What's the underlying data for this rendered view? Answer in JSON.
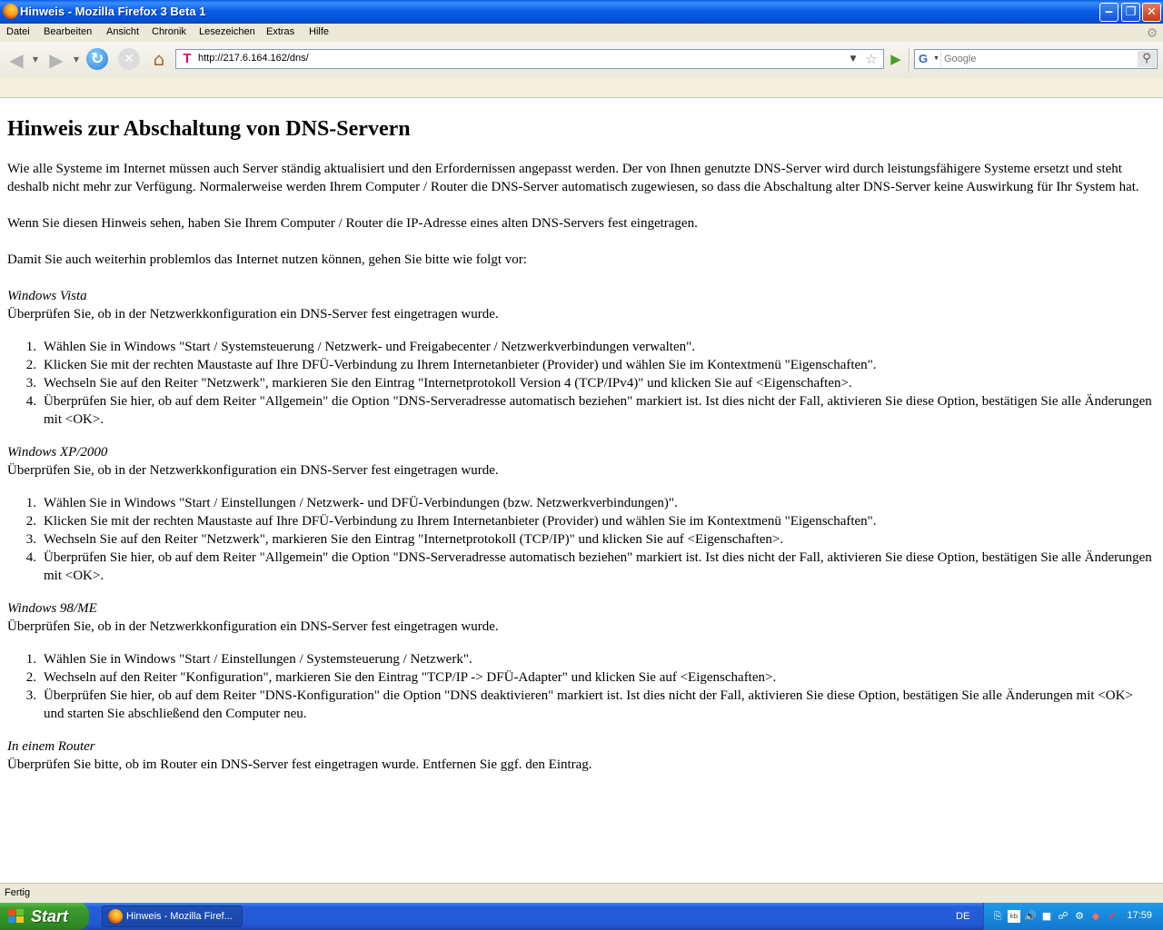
{
  "window": {
    "title": "Hinweis - Mozilla Firefox 3 Beta 1",
    "min_glyph": "‒",
    "max_glyph": "❐",
    "close_glyph": "✕"
  },
  "menu": {
    "items": [
      "Datei",
      "Bearbeiten",
      "Ansicht",
      "Chronik",
      "Lesezeichen",
      "Extras",
      "Hilfe"
    ]
  },
  "toolbar": {
    "back_glyph": "◀",
    "forward_glyph": "▶",
    "reload_glyph": "↻",
    "stop_glyph": "✕",
    "home_glyph": "⌂",
    "site_icon_letter": "T",
    "url": "http://217.6.164.162/dns/",
    "star_glyph": "☆",
    "go_glyph": "▶",
    "search_engine_letter": "G",
    "search_placeholder": "Google",
    "search_glyph": "⚲"
  },
  "page": {
    "heading": "Hinweis zur Abschaltung von DNS-Servern",
    "intro": "Wie alle Systeme im Internet müssen auch Server ständig aktualisiert und den Erfordernissen angepasst werden. Der von Ihnen genutzte DNS-Server wird durch leistungsfähigere Systeme ersetzt und steht deshalb nicht mehr zur Verfügung. Normalerweise werden Ihrem Computer / Router die DNS-Server automatisch zugewiesen, so dass die Abschaltung alter DNS-Server keine Auswirkung für Ihr System hat.",
    "para2": "Wenn Sie diesen Hinweis sehen, haben Sie Ihrem Computer / Router die IP-Adresse eines alten DNS-Servers fest eingetragen.",
    "para3": "Damit Sie auch weiterhin problemlos das Internet nutzen können, gehen Sie bitte wie folgt vor:",
    "sections": [
      {
        "title": "Windows Vista",
        "lead": "Überprüfen Sie, ob in der Netzwerkkonfiguration ein DNS-Server fest eingetragen wurde.",
        "steps": [
          "Wählen Sie in Windows \"Start / Systemsteuerung / Netzwerk- und Freigabecenter / Netzwerkverbindungen verwalten\".",
          "Klicken Sie mit der rechten Maustaste auf Ihre DFÜ-Verbindung zu Ihrem Internetanbieter (Provider) und wählen Sie im Kontextmenü \"Eigenschaften\".",
          "Wechseln Sie auf den Reiter \"Netzwerk\", markieren Sie den Eintrag \"Internetprotokoll Version 4 (TCP/IPv4)\" und klicken Sie auf <Eigenschaften>.",
          "Überprüfen Sie hier, ob auf dem Reiter \"Allgemein\" die Option \"DNS-Serveradresse automatisch beziehen\" markiert ist. Ist dies nicht der Fall, aktivieren Sie diese Option, bestätigen Sie alle Änderungen mit <OK>."
        ]
      },
      {
        "title": "Windows XP/2000",
        "lead": "Überprüfen Sie, ob in der Netzwerkkonfiguration ein DNS-Server fest eingetragen wurde.",
        "steps": [
          "Wählen Sie in Windows \"Start / Einstellungen / Netzwerk- und DFÜ-Verbindungen (bzw. Netzwerkverbindungen)\".",
          "Klicken Sie mit der rechten Maustaste auf Ihre DFÜ-Verbindung zu Ihrem Internetanbieter (Provider) und wählen Sie im Kontextmenü \"Eigenschaften\".",
          "Wechseln Sie auf den Reiter \"Netzwerk\", markieren Sie den Eintrag \"Internetprotokoll (TCP/IP)\" und klicken Sie auf <Eigenschaften>.",
          "Überprüfen Sie hier, ob auf dem Reiter \"Allgemein\" die Option \"DNS-Serveradresse automatisch beziehen\" markiert ist. Ist dies nicht der Fall, aktivieren Sie diese Option, bestätigen Sie alle Änderungen mit <OK>."
        ]
      },
      {
        "title": "Windows 98/ME",
        "lead": "Überprüfen Sie, ob in der Netzwerkkonfiguration ein DNS-Server fest eingetragen wurde.",
        "steps": [
          "Wählen Sie in Windows \"Start / Einstellungen / Systemsteuerung / Netzwerk\".",
          "Wechseln auf den Reiter \"Konfiguration\", markieren Sie den Eintrag \"TCP/IP -> DFÜ-Adapter\" und klicken Sie auf <Eigenschaften>.",
          "Überprüfen Sie hier, ob auf dem Reiter \"DNS-Konfiguration\" die Option \"DNS deaktivieren\" markiert ist. Ist dies nicht der Fall, aktivieren Sie diese Option, bestätigen Sie alle Änderungen mit <OK> und starten Sie abschließend den Computer neu."
        ]
      },
      {
        "title": "In einem Router",
        "lead": "Überprüfen Sie bitte, ob im Router ein DNS-Server fest eingetragen wurde. Entfernen Sie ggf. den Eintrag.",
        "steps": []
      }
    ]
  },
  "status": {
    "text": "Fertig"
  },
  "taskbar": {
    "start_label": "Start",
    "task_label": "Hinweis - Mozilla Firef...",
    "language": "DE",
    "clock": "17:59"
  }
}
